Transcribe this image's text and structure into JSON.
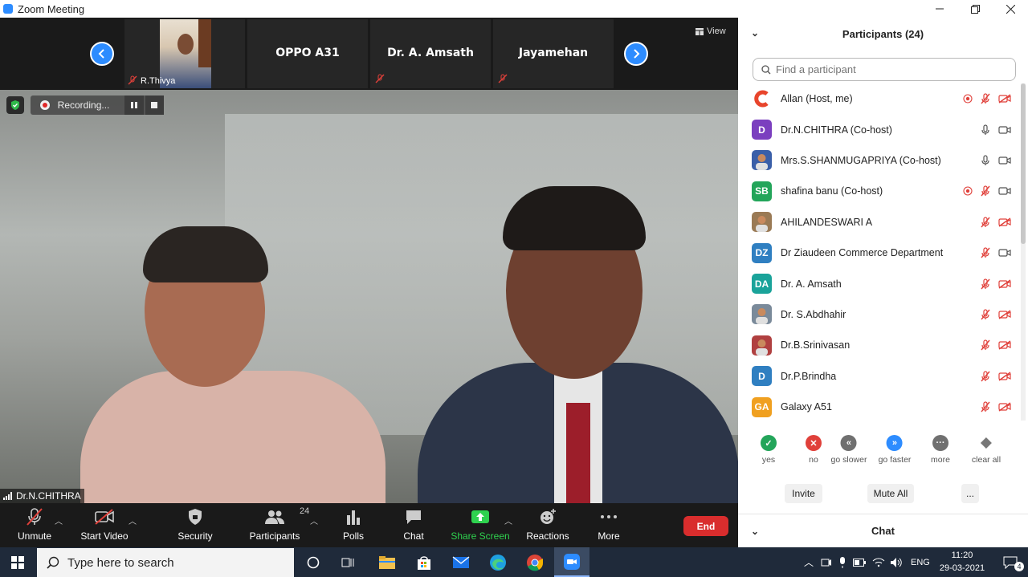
{
  "window": {
    "title": "Zoom Meeting",
    "controls": [
      "minimize-icon",
      "restore-icon",
      "close-icon"
    ]
  },
  "strip": {
    "view_label": "View",
    "tiles": [
      {
        "name": "R.Thivya"
      },
      {
        "name": "OPPO A31"
      },
      {
        "name": "Dr. A. Amsath"
      },
      {
        "name": "Jayamehan"
      }
    ]
  },
  "video": {
    "recording_label": "Recording...",
    "speaker_name": "Dr.N.CHITHRA"
  },
  "toolbar": {
    "unmute": "Unmute",
    "start_video": "Start Video",
    "security": "Security",
    "participants": "Participants",
    "participants_count": "24",
    "polls": "Polls",
    "chat": "Chat",
    "share_screen": "Share Screen",
    "reactions": "Reactions",
    "more": "More",
    "end": "End"
  },
  "panel": {
    "title": "Participants (24)",
    "search_placeholder": "Find a participant",
    "participants": [
      {
        "name": "Allan (Host, me)",
        "avatar": "C",
        "color": "#ffffff",
        "recording": true,
        "mic": "muted",
        "video": "off"
      },
      {
        "name": "Dr.N.CHITHRA (Co-host)",
        "avatar": "D",
        "color": "#7b3fbf",
        "recording": false,
        "mic": "on",
        "video": "on"
      },
      {
        "name": "Mrs.S.SHANMUGAPRIYA (Co-host)",
        "avatar": "",
        "color": "#3a5fa8",
        "recording": false,
        "mic": "on",
        "video": "on"
      },
      {
        "name": "shafina banu (Co-host)",
        "avatar": "SB",
        "color": "#23a55a",
        "recording": true,
        "mic": "muted",
        "video": "on"
      },
      {
        "name": "AHILANDESWARI A",
        "avatar": "",
        "color": "#9a7a55",
        "recording": false,
        "mic": "muted",
        "video": "off"
      },
      {
        "name": "Dr Ziaudeen Commerce Department",
        "avatar": "DZ",
        "color": "#2f7fc1",
        "recording": false,
        "mic": "muted",
        "video": "on"
      },
      {
        "name": "Dr. A. Amsath",
        "avatar": "DA",
        "color": "#1aa39a",
        "recording": false,
        "mic": "muted",
        "video": "off"
      },
      {
        "name": "Dr. S.Abdhahir",
        "avatar": "",
        "color": "#7a8a9a",
        "recording": false,
        "mic": "muted",
        "video": "off"
      },
      {
        "name": "Dr.B.Srinivasan",
        "avatar": "",
        "color": "#b04040",
        "recording": false,
        "mic": "muted",
        "video": "off"
      },
      {
        "name": "Dr.P.Brindha",
        "avatar": "D",
        "color": "#2f7fc1",
        "recording": false,
        "mic": "muted",
        "video": "off"
      },
      {
        "name": "Galaxy A51",
        "avatar": "GA",
        "color": "#f0a020",
        "recording": false,
        "mic": "muted",
        "video": "off"
      }
    ],
    "reactions": [
      {
        "label": "yes",
        "color": "#23a55a",
        "glyph": "✓"
      },
      {
        "label": "no",
        "color": "#e0403a",
        "glyph": "✕"
      },
      {
        "label": "go slower",
        "color": "#707070",
        "glyph": "«"
      },
      {
        "label": "go faster",
        "color": "#2d8cff",
        "glyph": "»"
      },
      {
        "label": "more",
        "color": "#707070",
        "glyph": "···"
      },
      {
        "label": "clear all",
        "color": "#ffffff",
        "glyph": ""
      }
    ],
    "invite": "Invite",
    "mute_all": "Mute All",
    "more": "...",
    "chat_title": "Chat"
  },
  "taskbar": {
    "search_placeholder": "Type here to search",
    "language": "ENG",
    "time": "11:20",
    "date": "29-03-2021",
    "notifications": "4"
  }
}
